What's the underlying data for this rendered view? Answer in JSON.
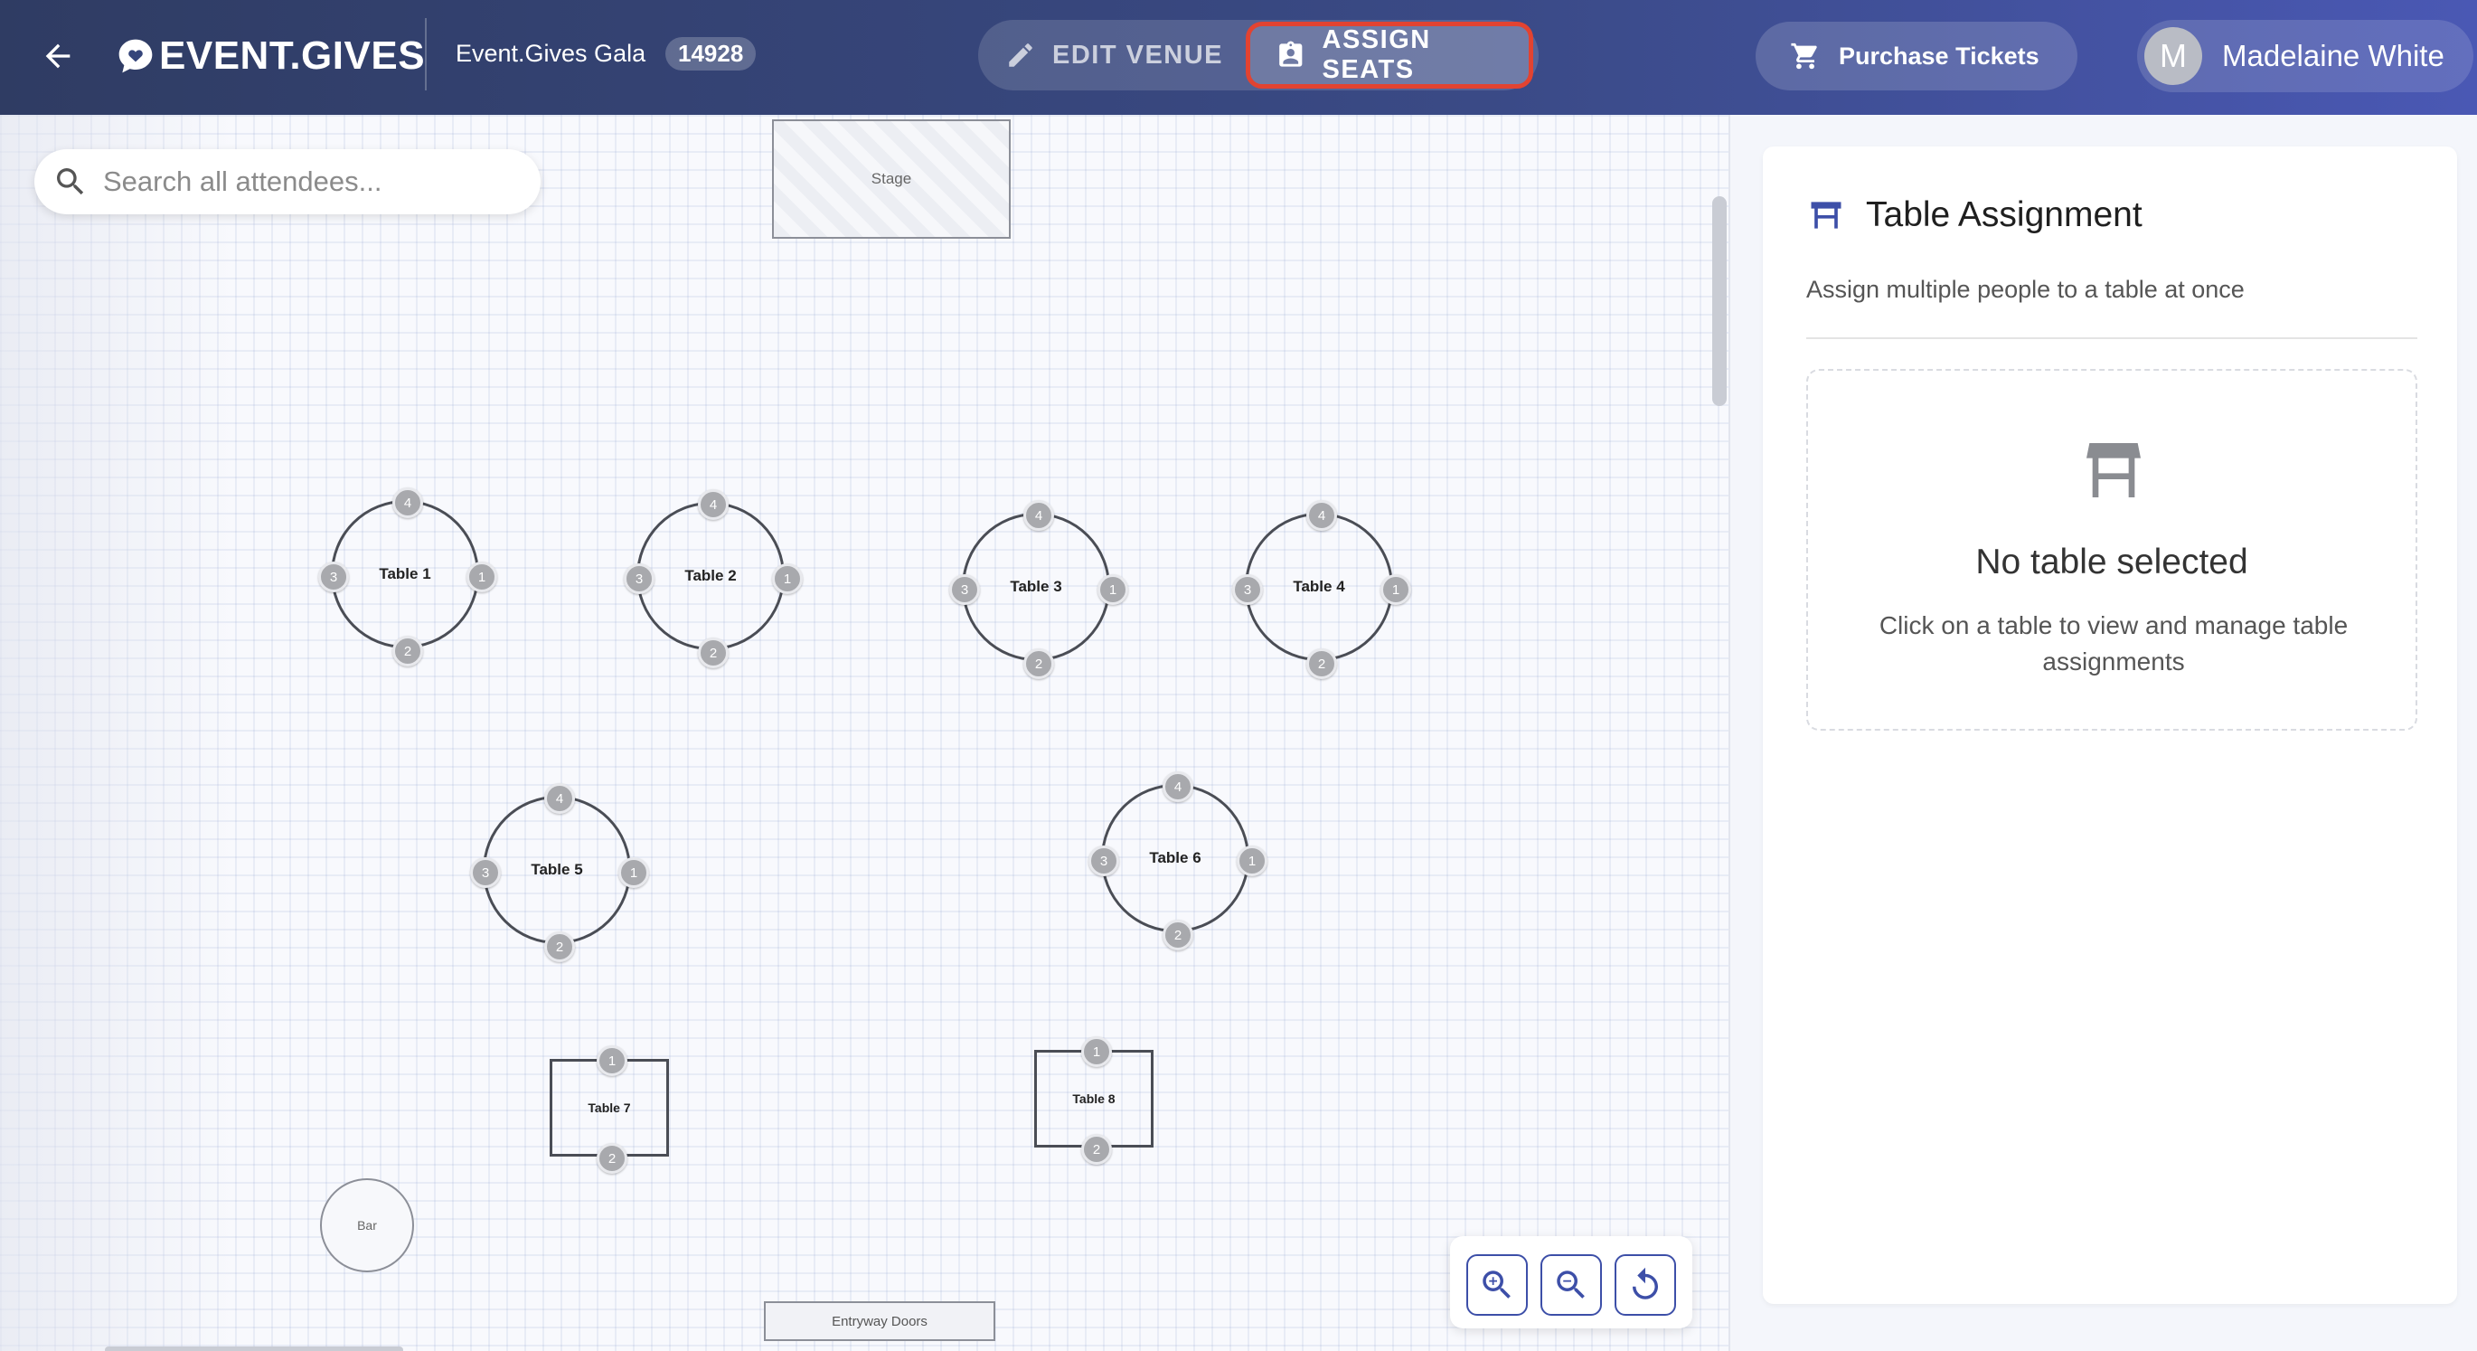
{
  "header": {
    "logo_text": "EVENT.GIVES",
    "event_name": "Event.Gives Gala",
    "event_id": "14928",
    "mode_tabs": [
      {
        "label": "EDIT VENUE",
        "active": false
      },
      {
        "label": "ASSIGN SEATS",
        "active": true
      }
    ],
    "purchase_label": "Purchase Tickets",
    "user_initial": "M",
    "user_name": "Madelaine White",
    "colors": {
      "highlight_border": "#e24331",
      "accent": "#3d4fa8"
    }
  },
  "canvas": {
    "search_placeholder": "Search all attendees...",
    "stage_label": "Stage",
    "doors_label": "Entryway Doors",
    "bar_label": "Bar",
    "round_tables": [
      {
        "label": "Table 1",
        "seats": [
          "1",
          "2",
          "3",
          "4"
        ]
      },
      {
        "label": "Table 2",
        "seats": [
          "1",
          "2",
          "3",
          "4"
        ]
      },
      {
        "label": "Table 3",
        "seats": [
          "1",
          "2",
          "3",
          "4"
        ]
      },
      {
        "label": "Table 4",
        "seats": [
          "1",
          "2",
          "3",
          "4"
        ]
      },
      {
        "label": "Table 5",
        "seats": [
          "1",
          "2",
          "3",
          "4"
        ]
      },
      {
        "label": "Table 6",
        "seats": [
          "1",
          "2",
          "3",
          "4"
        ]
      }
    ],
    "square_tables": [
      {
        "label": "Table 7",
        "seats": [
          "1",
          "2"
        ]
      },
      {
        "label": "Table 8",
        "seats": [
          "1",
          "2"
        ]
      }
    ],
    "zoom_controls": [
      "zoom-in-icon",
      "zoom-out-icon",
      "reset-icon"
    ]
  },
  "panel": {
    "title": "Table Assignment",
    "subtitle": "Assign multiple people to a table at once",
    "empty_title": "No table selected",
    "empty_text": "Click on a table to view and manage table assignments"
  }
}
